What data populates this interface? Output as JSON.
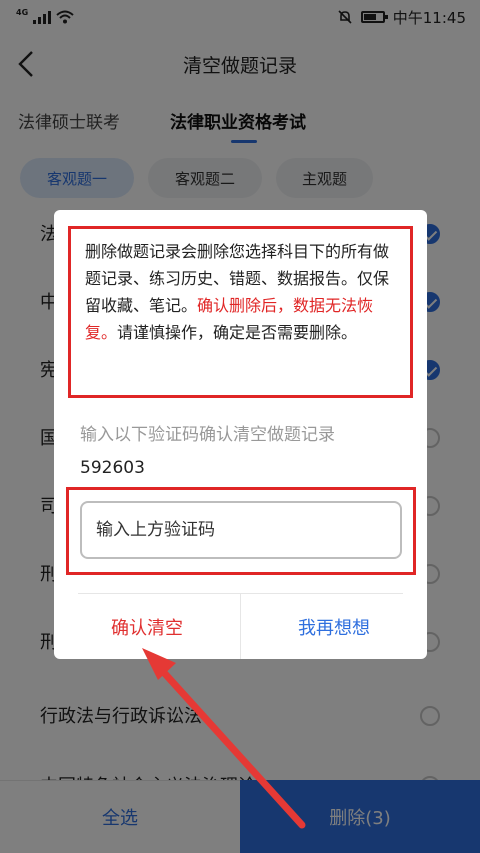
{
  "status_bar": {
    "network": "4G",
    "time": "中午11:45"
  },
  "header": {
    "title": "清空做题记录"
  },
  "tabs": [
    {
      "label": "法律硕士联考"
    },
    {
      "label": "法律职业资格考试"
    }
  ],
  "chips": [
    {
      "label": "客观题一"
    },
    {
      "label": "客观题二"
    },
    {
      "label": "主观题"
    }
  ],
  "subjects": [
    {
      "label": "法理学",
      "checked": true
    },
    {
      "label": "中",
      "checked": true
    },
    {
      "label": "宪",
      "checked": true
    },
    {
      "label": "国",
      "checked": false
    },
    {
      "label": "司",
      "checked": false
    },
    {
      "label": "刑",
      "checked": false
    },
    {
      "label": "刑",
      "checked": false
    },
    {
      "label": "行政法与行政诉讼法",
      "checked": false
    },
    {
      "label": "中国特色社会主义法治理论",
      "checked": false
    }
  ],
  "bottom_bar": {
    "select_all": "全选",
    "delete": "删除(3)"
  },
  "dialog": {
    "warning_part1": "删除做题记录会删除您选择科目下的所有做题记录、练习历史、错题、数据报告。仅保留收藏、笔记。",
    "warning_highlight": "确认删除后，数据无法恢复。",
    "warning_part2": "请谨慎操作，确定是否需要删除。",
    "prompt": "输入以下验证码确认清空做题记录",
    "code": "592603",
    "input_placeholder": "输入上方验证码",
    "confirm": "确认清空",
    "cancel": "我再想想"
  },
  "colors": {
    "accent": "#2f6fde",
    "danger": "#e02626",
    "annotation_arrow": "#e53935"
  }
}
